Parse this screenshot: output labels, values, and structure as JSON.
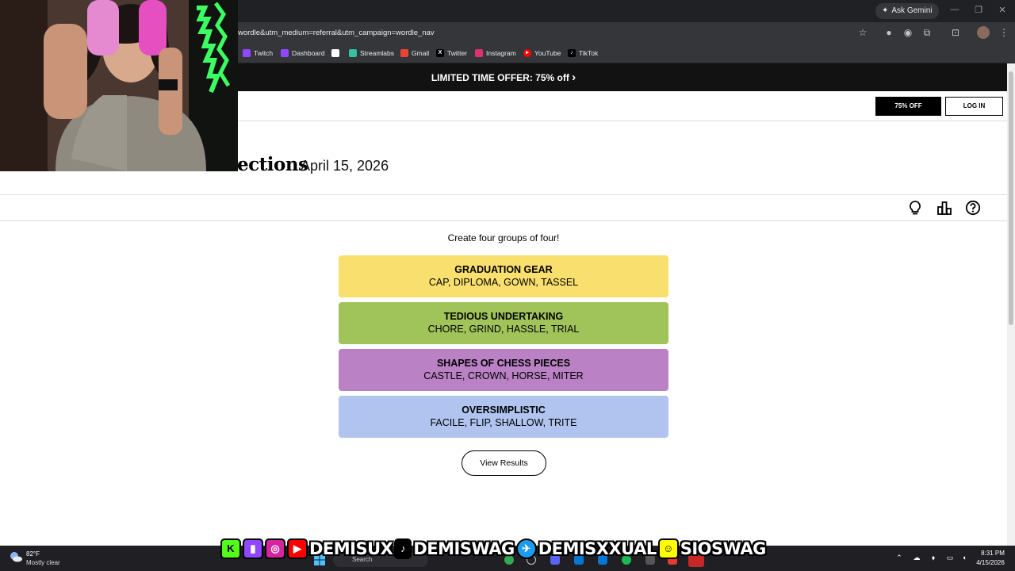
{
  "browser": {
    "ask_gemini_label": "Ask Gemini",
    "url": "wordle&utm_medium=referral&utm_campaign=wordle_nav",
    "bookmarks": [
      {
        "label": "Twitch",
        "color": "#9146ff"
      },
      {
        "label": "Dashboard",
        "color": "#9146ff"
      },
      {
        "label": "",
        "color": "#ffffff"
      },
      {
        "label": "Streamlabs",
        "color": "#31c3a2"
      },
      {
        "label": "Gmail",
        "color": "#ea4335"
      },
      {
        "label": "Twitter",
        "color": "#000000"
      },
      {
        "label": "Instagram",
        "color": "#e1306c"
      },
      {
        "label": "YouTube",
        "color": "#ff0000"
      },
      {
        "label": "TikTok",
        "color": "#000000"
      }
    ]
  },
  "promo": {
    "text": "LIMITED TIME OFFER:  75% off",
    "chevron": "›"
  },
  "header": {
    "offer_button": "75% OFF",
    "login_button": "LOG IN"
  },
  "game": {
    "title_fragment": "ections",
    "date": "April 15, 2026",
    "instructions": "Create four groups of four!",
    "groups": [
      {
        "name": "GRADUATION GEAR",
        "words": "CAP, DIPLOMA, GOWN, TASSEL",
        "color": "#f9df6d"
      },
      {
        "name": "TEDIOUS UNDERTAKING",
        "words": "CHORE, GRIND, HASSLE, TRIAL",
        "color": "#a0c35a"
      },
      {
        "name": "SHAPES OF CHESS PIECES",
        "words": "CASTLE, CROWN, HORSE, MITER",
        "color": "#ba81c5"
      },
      {
        "name": "OVERSIMPLISTIC",
        "words": "FACILE, FLIP, SHALLOW, TRITE",
        "color": "#b0c4ef"
      }
    ],
    "view_results": "View Results"
  },
  "overlay": {
    "handles": [
      "DEMISUX",
      "DEMISWAG",
      "DEMISXXUAL",
      "SIOSWAG"
    ]
  },
  "taskbar": {
    "weather_temp": "82°F",
    "weather_desc": "Mostly clear",
    "search_label": "Search",
    "time": "8:31 PM",
    "date": "4/15/2026"
  }
}
